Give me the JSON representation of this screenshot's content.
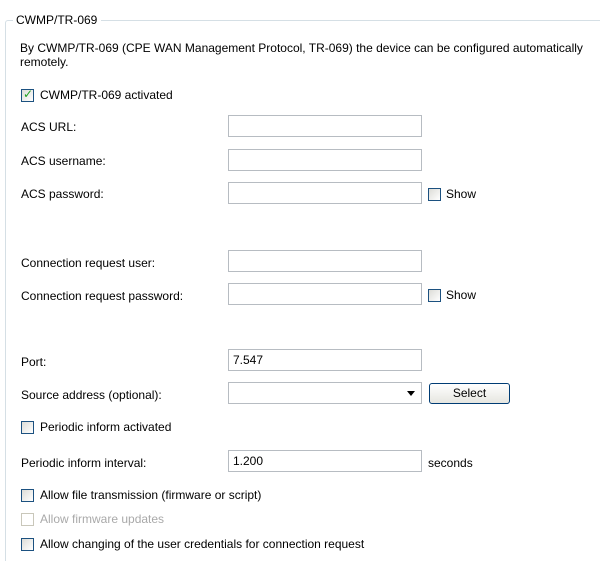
{
  "group_title": "CWMP/TR-069",
  "description": "By CWMP/TR-069 (CPE WAN Management Protocol, TR-069) the device can be configured automatically remotely.",
  "activated": {
    "label": "CWMP/TR-069 activated",
    "checked": true
  },
  "fields": {
    "acs_url": {
      "label": "ACS URL:",
      "value": ""
    },
    "acs_username": {
      "label": "ACS username:",
      "value": ""
    },
    "acs_password": {
      "label": "ACS password:",
      "value": "",
      "show_label": "Show"
    },
    "conn_user": {
      "label": "Connection request user:",
      "value": ""
    },
    "conn_password": {
      "label": "Connection request password:",
      "value": "",
      "show_label": "Show"
    },
    "port": {
      "label": "Port:",
      "value": "7.547"
    },
    "source_address": {
      "label": "Source address (optional):",
      "value": "",
      "button_label": "Select"
    },
    "periodic_interval": {
      "label": "Periodic inform interval:",
      "value": "1.200",
      "unit": "seconds"
    }
  },
  "periodic_activated": {
    "label": "Periodic inform activated",
    "checked": false
  },
  "allow_file_transmission": {
    "label": "Allow file transmission (firmware or script)",
    "checked": false
  },
  "allow_firmware_updates": {
    "label": "Allow firmware updates",
    "checked": false,
    "enabled": false
  },
  "allow_credentials_change": {
    "label": "Allow changing of the user credentials for connection request",
    "checked": false
  }
}
